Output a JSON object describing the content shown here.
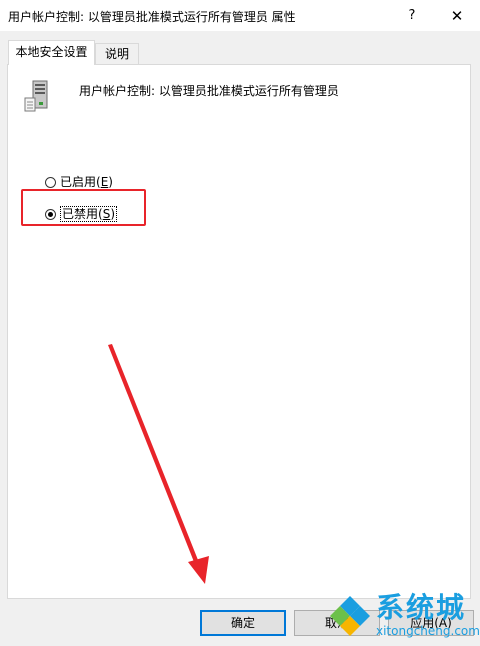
{
  "window": {
    "title": "用户帐户控制: 以管理员批准模式运行所有管理员 属性",
    "help_label": "?",
    "close_label": "✕"
  },
  "tabs": [
    {
      "label": "本地安全设置",
      "active": true
    },
    {
      "label": "说明",
      "active": false
    }
  ],
  "policy": {
    "icon": "server-policy-icon",
    "title": "用户帐户控制: 以管理员批准模式运行所有管理员"
  },
  "options": [
    {
      "label_prefix": "已启用(",
      "mnemonic": "E",
      "label_suffix": ")",
      "checked": false
    },
    {
      "label_prefix": "已禁用(",
      "mnemonic": "S",
      "label_suffix": ")",
      "checked": true
    }
  ],
  "buttons": {
    "ok": "确定",
    "cancel": "取消",
    "apply": "应用(A)"
  },
  "annotation": {
    "color": "#e8242a"
  },
  "watermark": {
    "brand": "系统城",
    "url": "xitongcheng.com"
  },
  "colors": {
    "accent": "#0078d7",
    "watermark_blue": "#1a9ee0"
  }
}
